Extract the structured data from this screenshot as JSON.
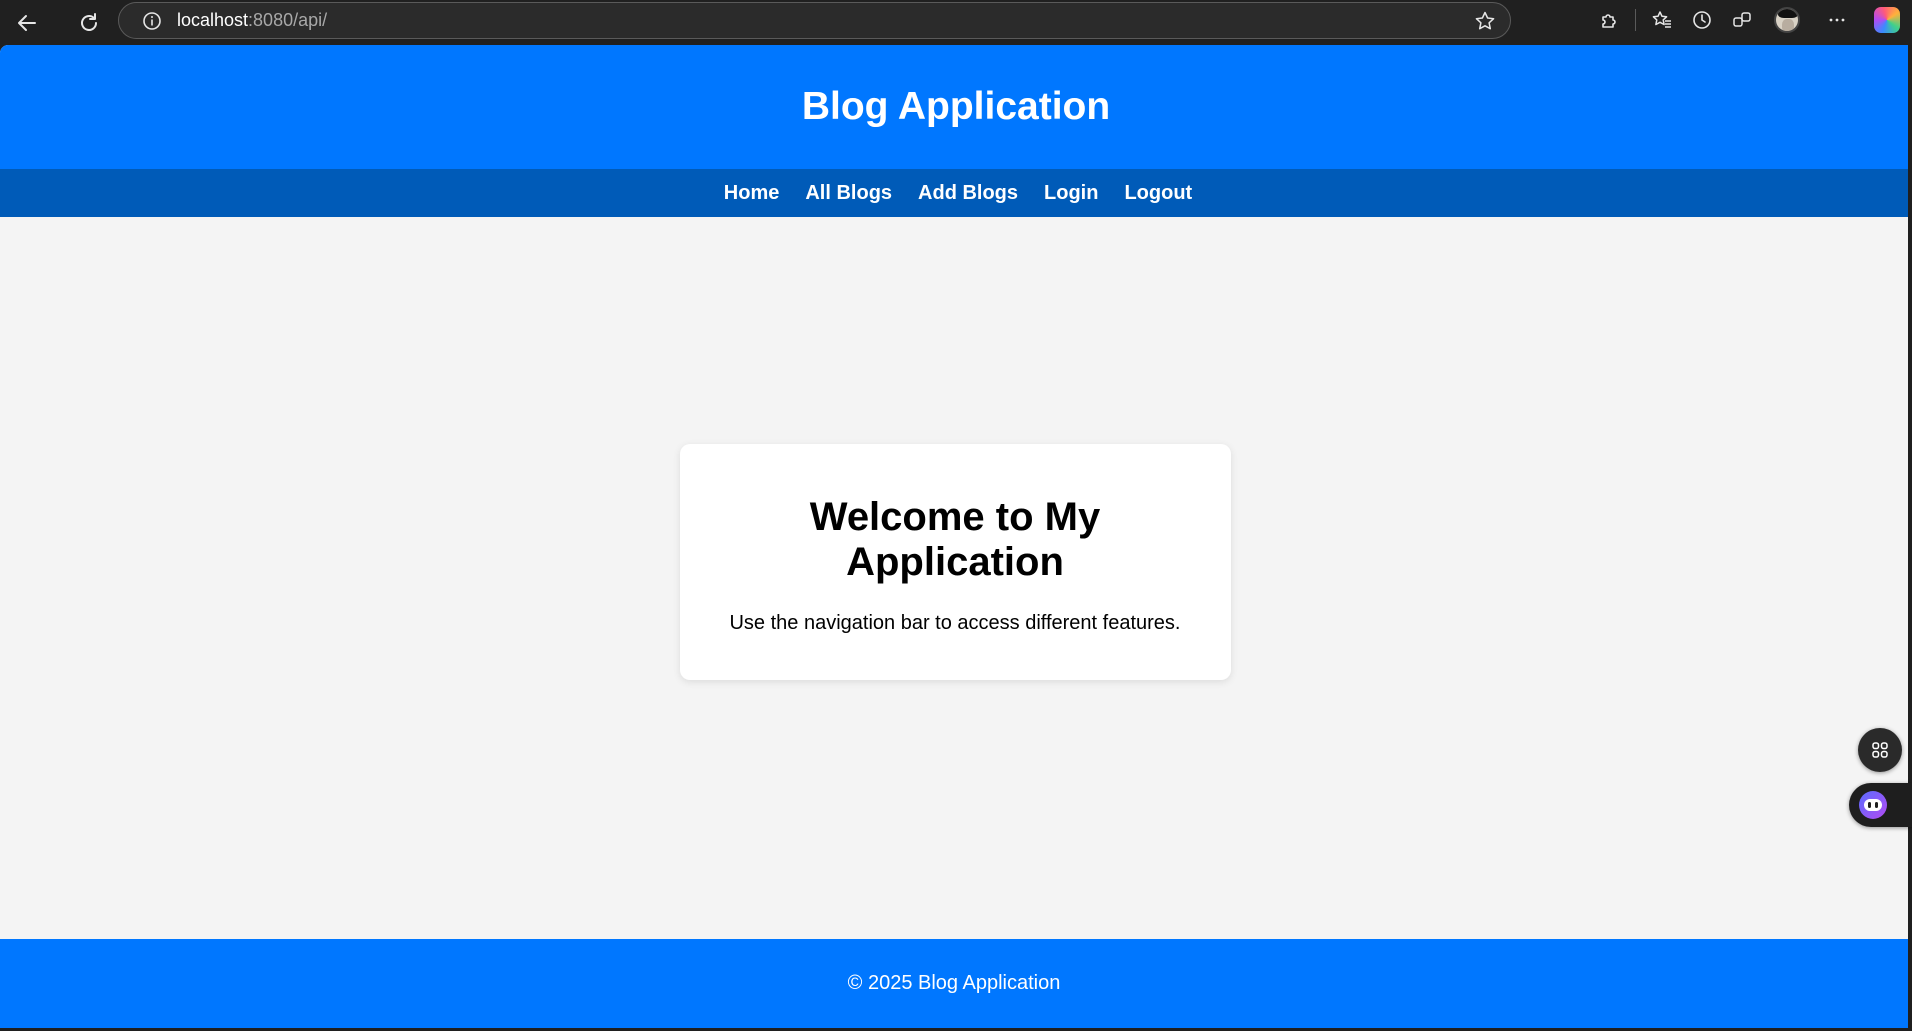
{
  "browser": {
    "url_host": "localhost",
    "url_rest": ":8080/api/",
    "icons": [
      "back-arrow-icon",
      "reload-icon",
      "info-icon",
      "star-icon",
      "extensions-icon",
      "favorites-icon",
      "history-icon",
      "collections-icon",
      "profile-avatar",
      "more-icon",
      "copilot-icon"
    ]
  },
  "header": {
    "title": "Blog Application"
  },
  "nav": {
    "items": [
      {
        "label": "Home"
      },
      {
        "label": "All Blogs"
      },
      {
        "label": "Add Blogs"
      },
      {
        "label": "Login"
      },
      {
        "label": "Logout"
      }
    ]
  },
  "main": {
    "heading": "Welcome to My Application",
    "text": "Use the navigation bar to access different features."
  },
  "footer": {
    "text": "© 2025 Blog Application"
  },
  "colors": {
    "header_bg": "#0077ff",
    "nav_bg": "#005bb8",
    "page_bg": "#f4f4f4",
    "card_bg": "#ffffff",
    "footer_bg": "#0077ff"
  }
}
